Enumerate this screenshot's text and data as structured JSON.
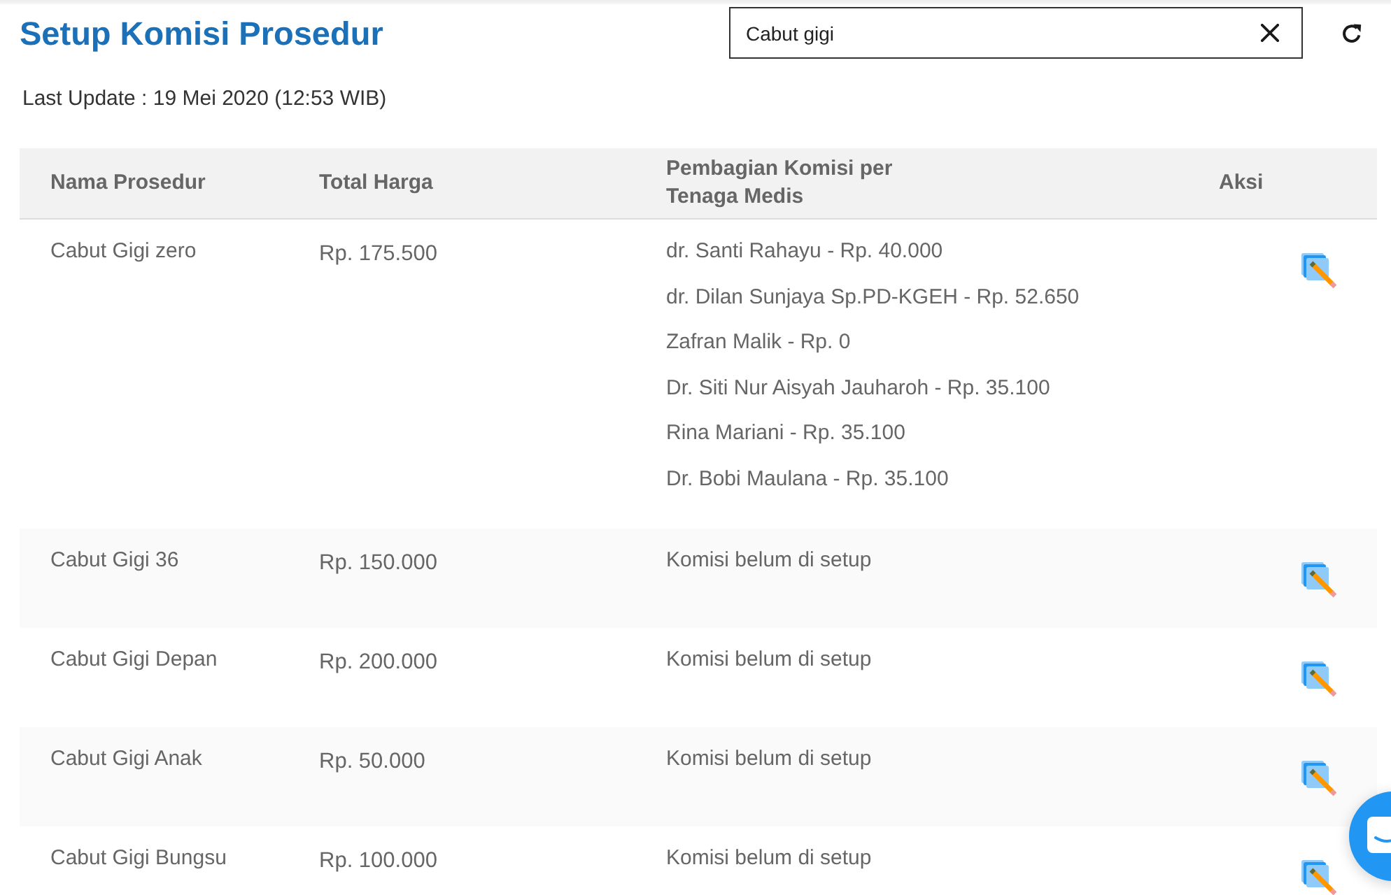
{
  "header": {
    "title": "Setup Komisi Prosedur",
    "search": {
      "value": "Cabut gigi"
    },
    "last_update": "Last Update : 19 Mei 2020 (12:53 WIB)"
  },
  "table": {
    "columns": [
      "Nama Prosedur",
      "Total Harga",
      "Pembagian Komisi per Tenaga Medis",
      "Aksi"
    ],
    "rows": [
      {
        "name": "Cabut Gigi zero",
        "total": "Rp. 175.500",
        "commissions": [
          "dr. Santi Rahayu - Rp. 40.000",
          "dr. Dilan Sunjaya Sp.PD-KGEH - Rp. 52.650",
          "Zafran Malik - Rp. 0",
          "Dr. Siti Nur Aisyah Jauharoh - Rp. 35.100",
          "Rina Mariani - Rp. 35.100",
          "Dr. Bobi Maulana - Rp. 35.100"
        ]
      },
      {
        "name": "Cabut Gigi 36",
        "total": "Rp. 150.000",
        "commission_note": "Komisi belum di setup"
      },
      {
        "name": "Cabut Gigi Depan",
        "total": "Rp. 200.000",
        "commission_note": "Komisi belum di setup"
      },
      {
        "name": "Cabut Gigi Anak",
        "total": "Rp. 50.000",
        "commission_note": "Komisi belum di setup"
      },
      {
        "name": "Cabut Gigi Bungsu",
        "total": "Rp. 100.000",
        "commission_note": "Komisi belum di setup"
      }
    ]
  }
}
